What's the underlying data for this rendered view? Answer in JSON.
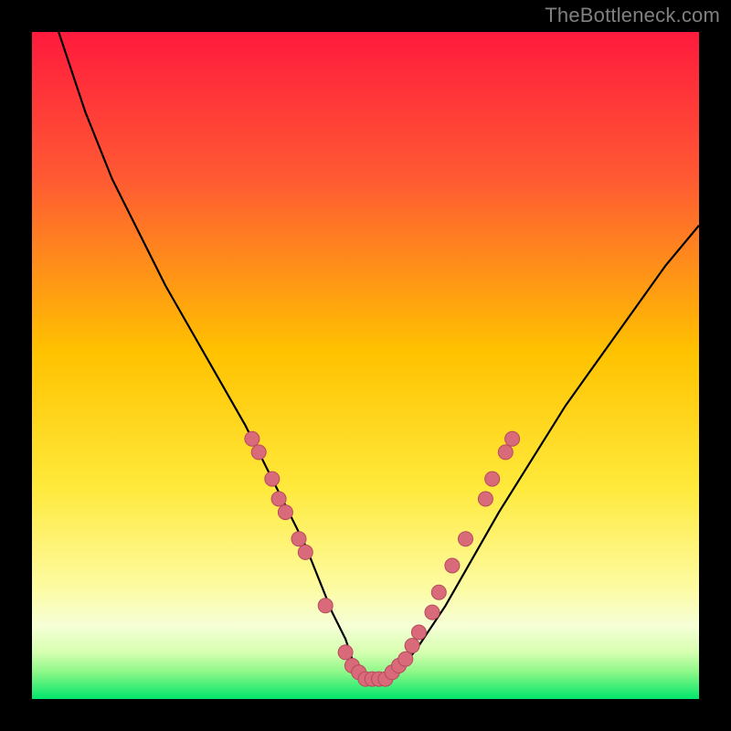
{
  "watermark": "TheBottleneck.com",
  "colors": {
    "page_bg": "#000000",
    "gradient_top": "#ff1a3d",
    "gradient_mid_upper": "#ff6a2a",
    "gradient_mid": "#ffd400",
    "gradient_mid_lower": "#fff570",
    "gradient_lower_band": "#f9ffd0",
    "gradient_bottom": "#00e66b",
    "curve": "#000000",
    "marker_fill": "#d86a7a",
    "marker_stroke": "#b64a5c",
    "watermark_color": "#808080"
  },
  "chart_data": {
    "type": "line",
    "title": "",
    "xlabel": "",
    "ylabel": "",
    "xlim": [
      0,
      100
    ],
    "ylim": [
      0,
      100
    ],
    "series": [
      {
        "name": "bottleneck-curve",
        "x": [
          0,
          4,
          8,
          12,
          16,
          20,
          24,
          28,
          32,
          35,
          38,
          41,
          43,
          45,
          47,
          48,
          49,
          50,
          51,
          53,
          55,
          58,
          62,
          66,
          70,
          75,
          80,
          85,
          90,
          95,
          100
        ],
        "y": [
          115,
          100,
          88,
          78,
          70,
          62,
          55,
          48,
          41,
          35,
          29,
          23,
          18,
          13,
          9,
          6,
          4,
          3,
          3,
          3,
          4,
          8,
          14,
          21,
          28,
          36,
          44,
          51,
          58,
          65,
          71
        ]
      }
    ],
    "markers": {
      "name": "highlighted-points",
      "points": [
        {
          "x": 33,
          "y": 39
        },
        {
          "x": 34,
          "y": 37
        },
        {
          "x": 36,
          "y": 33
        },
        {
          "x": 37,
          "y": 30
        },
        {
          "x": 38,
          "y": 28
        },
        {
          "x": 40,
          "y": 24
        },
        {
          "x": 41,
          "y": 22
        },
        {
          "x": 44,
          "y": 14
        },
        {
          "x": 47,
          "y": 7
        },
        {
          "x": 48,
          "y": 5
        },
        {
          "x": 49,
          "y": 4
        },
        {
          "x": 50,
          "y": 3
        },
        {
          "x": 51,
          "y": 3
        },
        {
          "x": 52,
          "y": 3
        },
        {
          "x": 53,
          "y": 3
        },
        {
          "x": 54,
          "y": 4
        },
        {
          "x": 55,
          "y": 5
        },
        {
          "x": 56,
          "y": 6
        },
        {
          "x": 57,
          "y": 8
        },
        {
          "x": 58,
          "y": 10
        },
        {
          "x": 60,
          "y": 13
        },
        {
          "x": 61,
          "y": 16
        },
        {
          "x": 63,
          "y": 20
        },
        {
          "x": 65,
          "y": 24
        },
        {
          "x": 68,
          "y": 30
        },
        {
          "x": 69,
          "y": 33
        },
        {
          "x": 71,
          "y": 37
        },
        {
          "x": 72,
          "y": 39
        }
      ]
    }
  }
}
